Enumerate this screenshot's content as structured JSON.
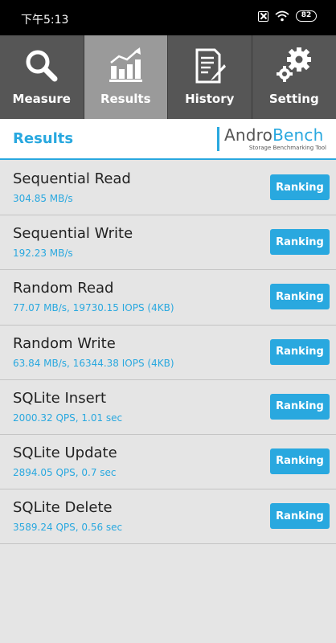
{
  "status_bar": {
    "time": "下午5:13",
    "battery": "82"
  },
  "tabs": [
    {
      "label": "Measure",
      "icon": "search-icon",
      "active": false
    },
    {
      "label": "Results",
      "icon": "bar-chart-icon",
      "active": true
    },
    {
      "label": "History",
      "icon": "document-pen-icon",
      "active": false
    },
    {
      "label": "Setting",
      "icon": "gear-icon",
      "active": false
    }
  ],
  "header": {
    "title": "Results",
    "logo_main_a": "Andro",
    "logo_main_b": "Bench",
    "logo_sub": "Storage Benchmarking Tool"
  },
  "results": [
    {
      "name": "Sequential Read",
      "value": "304.85 MB/s",
      "button": "Ranking"
    },
    {
      "name": "Sequential Write",
      "value": "192.23 MB/s",
      "button": "Ranking"
    },
    {
      "name": "Random Read",
      "value": "77.07 MB/s, 19730.15 IOPS (4KB)",
      "button": "Ranking"
    },
    {
      "name": "Random Write",
      "value": "63.84 MB/s, 16344.38 IOPS (4KB)",
      "button": "Ranking"
    },
    {
      "name": "SQLite Insert",
      "value": "2000.32 QPS, 1.01 sec",
      "button": "Ranking"
    },
    {
      "name": "SQLite Update",
      "value": "2894.05 QPS, 0.7 sec",
      "button": "Ranking"
    },
    {
      "name": "SQLite Delete",
      "value": "3589.24 QPS, 0.56 sec",
      "button": "Ranking"
    }
  ],
  "colors": {
    "accent": "#29a8df",
    "tab_bg": "#565656",
    "tab_active_bg": "#9a9a9a",
    "list_bg": "#e5e5e5"
  }
}
